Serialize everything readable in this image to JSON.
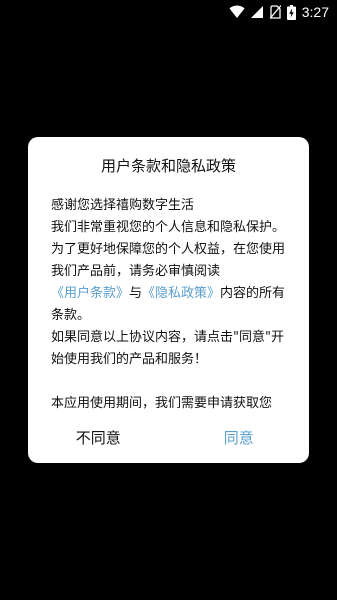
{
  "status_bar": {
    "time": "3:27",
    "icons": [
      "wifi-icon",
      "signal-icon",
      "no-sim-icon",
      "battery-charging-icon"
    ]
  },
  "dialog": {
    "title": "用户条款和隐私政策",
    "greeting": "感谢您选择禧购数字生活",
    "para1_a": "我们非常重视您的个人信息和隐私保护。为了更好地保障您的个人权益，在您使用我们产品前，请务必审慎阅读",
    "link_terms": "《用户条款》",
    "para1_and": "与",
    "link_privacy": "《隐私政策》",
    "para1_b": "内容的所有条款。",
    "para2": " 如果同意以上协议内容，请点击\"同意\"开始使用我们的产品和服务！",
    "para3": "本应用使用期间，我们需要申请获取您",
    "disagree_label": "不同意",
    "agree_label": "同意"
  },
  "colors": {
    "background": "#000000",
    "dialog_bg": "#ffffff",
    "accent": "#5a9fcc",
    "text": "#111111"
  }
}
